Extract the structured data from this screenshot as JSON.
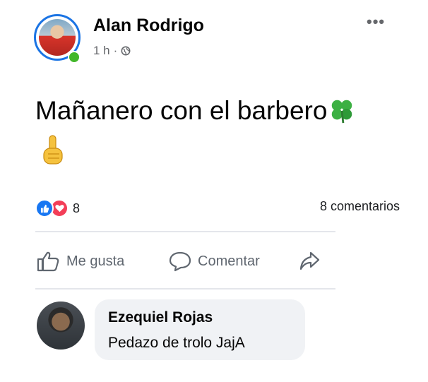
{
  "post": {
    "author": "Alan Rodrigo",
    "time": "1 h",
    "separator": "·",
    "text": "Mañanero con el barbero",
    "emojis": [
      "clover-icon",
      "index-finger-up-icon"
    ],
    "reaction_count": "8",
    "comments_count": "8 comentarios"
  },
  "actions": {
    "like_label": "Me gusta",
    "comment_label": "Comentar"
  },
  "comment": {
    "author": "Ezequiel Rojas",
    "text": "Pedazo de trolo JajA"
  },
  "colors": {
    "like_blue": "#1877f2",
    "love_red": "#f33e58",
    "online_green": "#42b72a",
    "clover_green": "#3cb043"
  }
}
